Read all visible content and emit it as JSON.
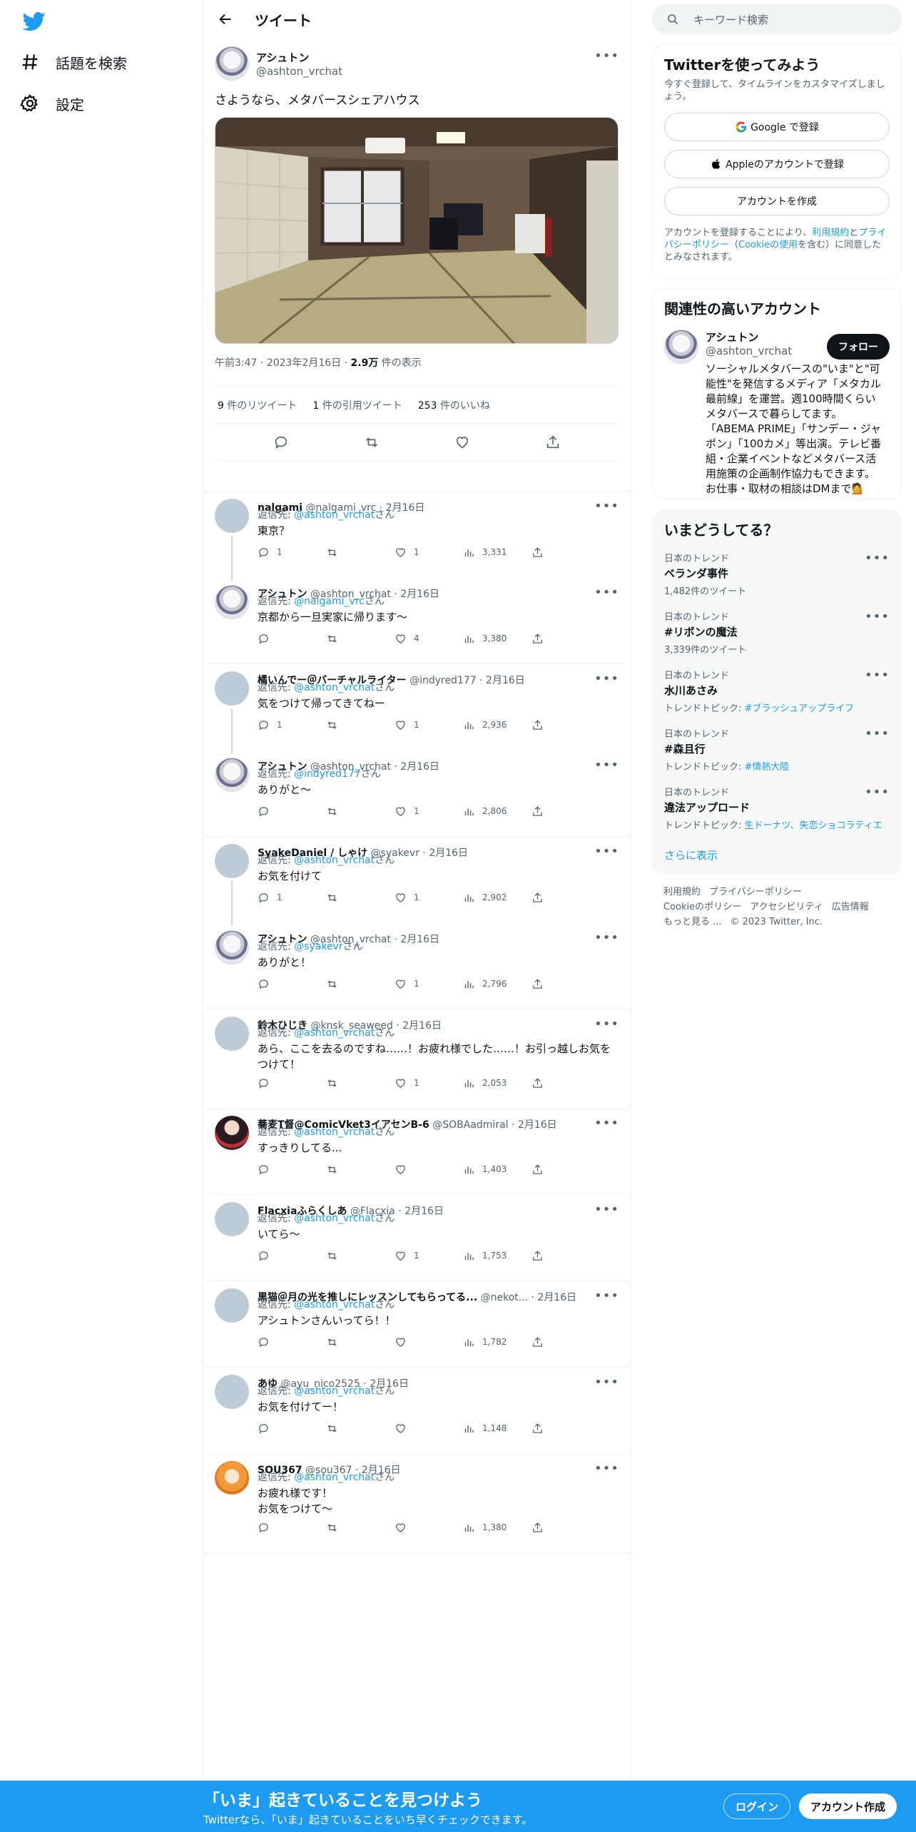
{
  "nav": {
    "explore_label": "話題を検索",
    "settings_label": "設定"
  },
  "header": {
    "title": "ツイート"
  },
  "tweet": {
    "author_name": "アシュトン",
    "author_handle": "@ashton_vrchat",
    "text": "さようなら、メタバースシェアハウス",
    "time": "午前3:47",
    "date": "2023年2月16日",
    "views_count": "2.9万",
    "views_label": "件の表示",
    "retweets_count": "9",
    "retweets_label": "件のリツイート",
    "quotes_count": "1",
    "quotes_label": "件の引用ツイート",
    "likes_count": "253",
    "likes_label": "件のいいね"
  },
  "reply_to_label": "返信先: ",
  "reply_suffix": "さん",
  "replies": [
    {
      "name": "nalgami",
      "handle": "@nalgami_vrc",
      "date": "2月16日",
      "to": "@ashton_vrchat",
      "text": "東京？",
      "replies": "1",
      "retweets": "",
      "likes": "1",
      "views": "3,331",
      "avatar": "grey",
      "thread": true,
      "sep": false
    },
    {
      "name": "アシュトン",
      "handle": "@ashton_vrchat",
      "date": "2月16日",
      "to": "@nalgami_vrc",
      "text": "京都から一旦実家に帰ります〜",
      "replies": "",
      "retweets": "",
      "likes": "4",
      "views": "3,380",
      "avatar": "ash",
      "thread": false,
      "sep": true
    },
    {
      "name": "橘いんでー＠バーチャルライター",
      "handle": "@indyred177",
      "date": "2月16日",
      "to": "@ashton_vrchat",
      "text": "気をつけて帰ってきてねー",
      "replies": "1",
      "retweets": "",
      "likes": "1",
      "views": "2,936",
      "avatar": "grey",
      "thread": true,
      "sep": false
    },
    {
      "name": "アシュトン",
      "handle": "@ashton_vrchat",
      "date": "2月16日",
      "to": "@indyred177",
      "text": "ありがと〜",
      "replies": "",
      "retweets": "",
      "likes": "1",
      "views": "2,806",
      "avatar": "ash",
      "thread": false,
      "sep": true
    },
    {
      "name": "SyakeDaniel / しゃけ",
      "handle": "@syakevr",
      "date": "2月16日",
      "to": "@ashton_vrchat",
      "text": "お気を付けて",
      "replies": "1",
      "retweets": "",
      "likes": "1",
      "views": "2,902",
      "avatar": "grey",
      "thread": true,
      "sep": false
    },
    {
      "name": "アシュトン",
      "handle": "@ashton_vrchat",
      "date": "2月16日",
      "to": "@syakevr",
      "text": "ありがと！",
      "replies": "",
      "retweets": "",
      "likes": "1",
      "views": "2,796",
      "avatar": "ash",
      "thread": false,
      "sep": true
    },
    {
      "name": "鈴木ひじき",
      "handle": "@knsk_seaweed",
      "date": "2月16日",
      "to": "@ashton_vrchat",
      "text": "あら、ここを去るのですね……！お疲れ様でした……！お引っ越しお気をつけて！",
      "replies": "",
      "retweets": "",
      "likes": "1",
      "views": "2,053",
      "avatar": "grey",
      "thread": false,
      "sep": true
    },
    {
      "name": "蕎麦T督@ComicVket3イアセンB-6",
      "handle": "@SOBAadmiral",
      "date": "2月16日",
      "to": "@ashton_vrchat",
      "text": "すっきりしてる...",
      "replies": "",
      "retweets": "",
      "likes": "",
      "views": "1,403",
      "avatar": "soba",
      "thread": false,
      "sep": true
    },
    {
      "name": "Flacxiaふらくしあ",
      "handle": "@Flacxia",
      "date": "2月16日",
      "to": "@ashton_vrchat",
      "text": "いてら～",
      "replies": "",
      "retweets": "",
      "likes": "1",
      "views": "1,753",
      "avatar": "grey",
      "thread": false,
      "sep": true
    },
    {
      "name": "黒猫＠月の光を推しにレッスンしてもらってる...",
      "handle": "@nekot...",
      "date": "2月16日",
      "to": "@ashton_vrchat",
      "text": "アシュトンさんいってら！！",
      "replies": "",
      "retweets": "",
      "likes": "",
      "views": "1,782",
      "avatar": "grey",
      "thread": false,
      "sep": true
    },
    {
      "name": "あゆ",
      "handle": "@ayu_nico2525",
      "date": "2月16日",
      "to": "@ashton_vrchat",
      "text": "お気を付けてー！",
      "replies": "",
      "retweets": "",
      "likes": "",
      "views": "1,148",
      "avatar": "grey",
      "thread": false,
      "sep": true
    },
    {
      "name": "SOU367",
      "handle": "@sou367",
      "date": "2月16日",
      "to": "@ashton_vrchat",
      "text": "お疲れ様です！\nお気をつけて〜",
      "replies": "",
      "retweets": "",
      "likes": "",
      "views": "1,380",
      "avatar": "sou",
      "thread": false,
      "sep": true
    }
  ],
  "search": {
    "placeholder": "キーワード検索"
  },
  "signup_card": {
    "title": "Twitterを使ってみよう",
    "subtitle": "今すぐ登録して、タイムラインをカスタマイズしましょう。",
    "google_label": "Google で登録",
    "apple_label": "Appleのアカウントで登録",
    "create_label": "アカウントを作成",
    "legal_prefix": "アカウントを登録することにより、",
    "terms_link": "利用規約",
    "and": "と",
    "privacy_link": "プライバシーポリシー",
    "paren_open": "（",
    "cookie_link": "Cookieの使用",
    "legal_suffix": "を含む）に同意したとみなされます。"
  },
  "related": {
    "title": "関連性の高いアカウント",
    "name": "アシュトン",
    "handle": "@ashton_vrchat",
    "follow_label": "フォロー",
    "bio": "ソーシャルメタバースの\"いま\"と\"可能性\"を発信するメディア「メタカル最前線」を運営。週100時間くらいメタバースで暮らしてます。「ABEMA PRIME」「サンデー・ジャポン」「100カメ」等出演。テレビ番組・企業イベントなどメタバース活用施策の企画制作協力もできます。お仕事・取材の相談はDMまで💁"
  },
  "trends": {
    "title": "いまどうしてる？",
    "items": [
      {
        "category": "日本のトレンド",
        "name": "ベランダ事件",
        "stat": "1,482件のツイート",
        "topic_prefix": "",
        "topic": ""
      },
      {
        "category": "日本のトレンド",
        "name": "#リボンの魔法",
        "stat": "3,339件のツイート",
        "topic_prefix": "",
        "topic": ""
      },
      {
        "category": "日本のトレンド",
        "name": "水川あさみ",
        "stat": "",
        "topic_prefix": "トレンドトピック: ",
        "topic": "#ブラッシュアップライフ"
      },
      {
        "category": "日本のトレンド",
        "name": "#森且行",
        "stat": "",
        "topic_prefix": "トレンドトピック: ",
        "topic": "#情熱大陸"
      },
      {
        "category": "日本のトレンド",
        "name": "違法アップロード",
        "stat": "",
        "topic_prefix": "トレンドトピック: ",
        "topic": "生ドーナツ、失恋ショコラティエ"
      }
    ],
    "show_more": "さらに表示"
  },
  "footer": {
    "links": [
      "利用規約",
      "プライバシーポリシー",
      "Cookieのポリシー",
      "アクセシビリティ",
      "広告情報",
      "もっと見る ..."
    ],
    "copyright": "© 2023 Twitter, Inc."
  },
  "bottom_bar": {
    "headline": "「いま」起きていることを見つけよう",
    "sub": "Twitterなら、「いま」起きていることをいち早くチェックできます。",
    "login_label": "ログイン",
    "signup_label": "アカウント作成"
  },
  "colors": {
    "accent": "#1d9bf0",
    "text": "#0f1419",
    "muted": "#536471"
  }
}
